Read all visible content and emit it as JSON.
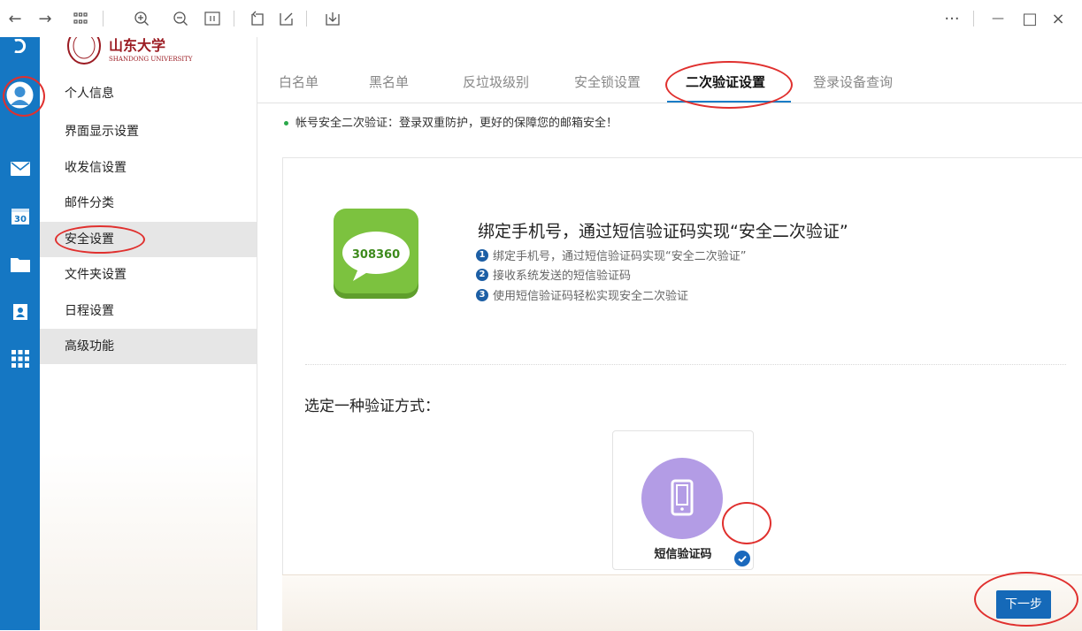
{
  "toolbar": {
    "back_icon": "←",
    "forward_icon": "→",
    "grid_icon": "grid-icon",
    "more": "···",
    "minimize": "—",
    "maximize": "□",
    "close": "×"
  },
  "logo": {
    "cn": "山东大学",
    "en": "SHANDONG UNIVERSITY"
  },
  "sidebar": {
    "items": [
      {
        "label": "个人信息"
      },
      {
        "label": "界面显示设置"
      },
      {
        "label": "收发信设置"
      },
      {
        "label": "邮件分类"
      },
      {
        "label": "安全设置"
      },
      {
        "label": "文件夹设置"
      },
      {
        "label": "日程设置"
      },
      {
        "label": "高级功能"
      }
    ]
  },
  "rail": {
    "calendar_day": "30"
  },
  "tabs": [
    {
      "label": "白名单"
    },
    {
      "label": "黑名单"
    },
    {
      "label": "反垃圾级别"
    },
    {
      "label": "安全锁设置"
    },
    {
      "label": "二次验证设置"
    },
    {
      "label": "登录设备查询"
    }
  ],
  "notice": "帐号安全二次验证：登录双重防护，更好的保障您的邮箱安全！",
  "intro": {
    "sms_code": "308360",
    "heading": "绑定手机号，通过短信验证码实现“安全二次验证”",
    "steps": [
      {
        "num": "1",
        "text": "绑定手机号，通过短信验证码实现“安全二次验证”"
      },
      {
        "num": "2",
        "text": "接收系统发送的短信验证码"
      },
      {
        "num": "3",
        "text": "使用短信验证码轻松实现安全二次验证"
      }
    ]
  },
  "method": {
    "prompt": "选定一种验证方式：",
    "option_label": "短信验证码",
    "selected": true
  },
  "next_button": "下一步",
  "colors": {
    "rail": "#1577c3",
    "accent": "#1569b8",
    "sms_green": "#7cc23f",
    "option_purple": "#b39ce5",
    "annotation_red": "#e0302e"
  }
}
